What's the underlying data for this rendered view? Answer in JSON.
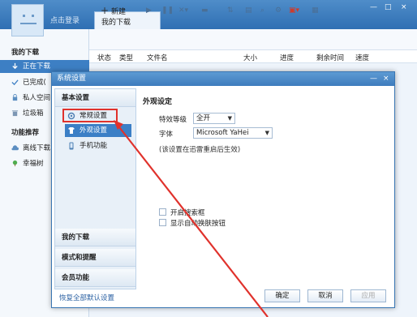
{
  "app": {
    "login_text": "点击登录",
    "window_tab": "我的下载",
    "controls": [
      "—",
      "□",
      "×"
    ]
  },
  "sidebar": {
    "my_downloads": "我的下载",
    "items": [
      {
        "label": "正在下载",
        "icon": "download-arrow-icon",
        "active": true
      },
      {
        "label": "已完成(",
        "icon": "check-icon"
      },
      {
        "label": "私人空间",
        "icon": "lock-icon"
      },
      {
        "label": "垃圾箱",
        "icon": "trash-icon"
      }
    ],
    "recommend": "功能推荐",
    "rec_items": [
      {
        "label": "离线下载",
        "icon": "cloud-icon"
      },
      {
        "label": "幸福树",
        "icon": "tree-icon"
      }
    ]
  },
  "toolbar": {
    "new_label": "新建",
    "icons": [
      "play-icon",
      "pause-icon",
      "delete-icon",
      "folder-icon",
      "sort-icon",
      "details-icon",
      "search-icon",
      "gear-icon",
      "vip-icon",
      "more-icon"
    ]
  },
  "columns": [
    "状态",
    "类型",
    "文件名",
    "大小",
    "进度",
    "剩余时间",
    "速度"
  ],
  "dialog": {
    "title": "系统设置",
    "controls": [
      "—",
      "×"
    ],
    "categories": {
      "basic": "基本设置",
      "my_downloads": "我的下载",
      "mode": "模式和提醒",
      "vip": "会员功能"
    },
    "sub_items": [
      {
        "label": "常规设置",
        "icon": "settings-icon"
      },
      {
        "label": "外观设置",
        "icon": "appearance-icon",
        "selected": true
      },
      {
        "label": "手机功能",
        "icon": "phone-icon"
      }
    ],
    "section_title": "外观设定",
    "effect_label": "特效等级",
    "effect_value": "全开",
    "font_label": "字体",
    "font_value": "Microsoft YaHei",
    "note": "(该设置在迅雷重启后生效)",
    "checkbox_search": "开启搜索框",
    "checkbox_button": "显示自动换肤按钮",
    "restore_link": "恢复全部默认设置",
    "ok": "确定",
    "cancel": "取消",
    "apply": "应用"
  },
  "colors": {
    "accent": "#3b7fc6",
    "annotation": "#e0322c"
  }
}
